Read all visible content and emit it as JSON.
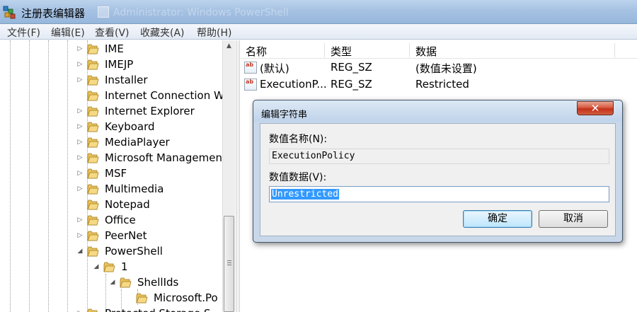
{
  "window": {
    "title": "注册表编辑器",
    "background_title": "Administrator: Windows PowerShell"
  },
  "menu": [
    "文件(F)",
    "编辑(E)",
    "查看(V)",
    "收藏夹(A)",
    "帮助(H)"
  ],
  "tree": {
    "items": [
      {
        "label": "IME",
        "expander": "▷",
        "level": 0
      },
      {
        "label": "IMEJP",
        "expander": "▷",
        "level": 0
      },
      {
        "label": "Installer",
        "expander": "▷",
        "level": 0
      },
      {
        "label": "Internet Connection W",
        "expander": "",
        "level": 0
      },
      {
        "label": "Internet Explorer",
        "expander": "▷",
        "level": 0
      },
      {
        "label": "Keyboard",
        "expander": "▷",
        "level": 0
      },
      {
        "label": "MediaPlayer",
        "expander": "▷",
        "level": 0
      },
      {
        "label": "Microsoft Managemen",
        "expander": "▷",
        "level": 0
      },
      {
        "label": "MSF",
        "expander": "▷",
        "level": 0
      },
      {
        "label": "Multimedia",
        "expander": "▷",
        "level": 0
      },
      {
        "label": "Notepad",
        "expander": "",
        "level": 0
      },
      {
        "label": "Office",
        "expander": "▷",
        "level": 0
      },
      {
        "label": "PeerNet",
        "expander": "▷",
        "level": 0
      },
      {
        "label": "PowerShell",
        "expander": "◢",
        "level": 0
      },
      {
        "label": "1",
        "expander": "◢",
        "level": 1
      },
      {
        "label": "ShellIds",
        "expander": "◢",
        "level": 2
      },
      {
        "label": "Microsoft.Po",
        "expander": "",
        "level": 3
      },
      {
        "label": "Protected Storage S",
        "expander": "▷",
        "level": 0
      }
    ]
  },
  "list": {
    "columns": [
      "名称",
      "类型",
      "数据"
    ],
    "rows": [
      {
        "name": "(默认)",
        "type": "REG_SZ",
        "data": "(数值未设置)"
      },
      {
        "name": "ExecutionP...",
        "type": "REG_SZ",
        "data": "Restricted"
      }
    ],
    "value_icon_text": "ab"
  },
  "dialog": {
    "title": "编辑字符串",
    "close_label": "✕",
    "name_label": "数值名称(N):",
    "name_value": "ExecutionPolicy",
    "data_label": "数值数据(V):",
    "data_value": "Unrestricted",
    "ok_label": "确定",
    "cancel_label": "取消"
  },
  "colors": {
    "selection": "#3399ff",
    "close_button": "#c4301a",
    "folder": "#e8c15a"
  }
}
